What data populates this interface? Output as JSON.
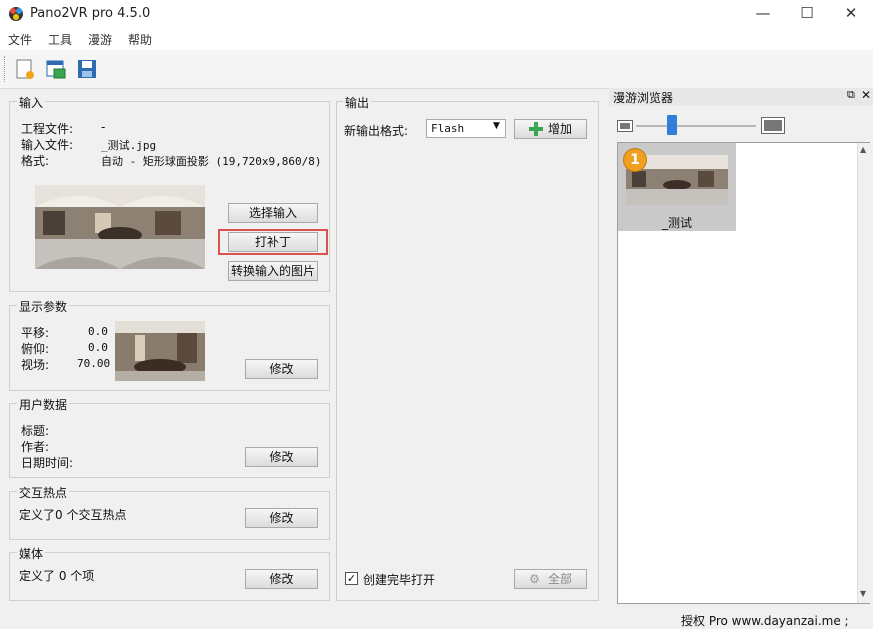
{
  "window": {
    "title": "Pano2VR pro 4.5.0",
    "minimize_glyph": "—",
    "maximize_glyph": "☐",
    "close_glyph": "✕"
  },
  "menu": [
    "文件",
    "工具",
    "漫游",
    "帮助"
  ],
  "toolbar": {
    "icons": [
      "new-project-icon",
      "open-project-icon",
      "save-project-icon"
    ]
  },
  "input_group": {
    "title": "输入",
    "project_file_label": "工程文件:",
    "project_file_value": "-",
    "input_file_label": "输入文件:",
    "input_file_value": "_测试.jpg",
    "format_label": "格式:",
    "format_value": "自动 - 矩形球面投影 (19,720x9,860/8)",
    "select_input_button": "选择输入",
    "patch_button": "打补丁",
    "convert_button": "转换输入的图片"
  },
  "display_group": {
    "title": "显示参数",
    "pan_label": "平移:",
    "pan_value": "0.0",
    "tilt_label": "俯仰:",
    "tilt_value": "0.0",
    "fov_label": "视场:",
    "fov_value": "70.00",
    "modify_button": "修改"
  },
  "user_data_group": {
    "title": "用户数据",
    "title_label": "标题:",
    "author_label": "作者:",
    "datetime_label": "日期时间:",
    "modify_button": "修改"
  },
  "hotspot_group": {
    "title": "交互热点",
    "summary": "定义了0 个交互热点",
    "modify_button": "修改"
  },
  "media_group": {
    "title": "媒体",
    "summary": "定义了 0 个项",
    "modify_button": "修改"
  },
  "output_group": {
    "title": "输出",
    "new_format_label": "新输出格式:",
    "format_selected": "Flash",
    "add_button": "增加",
    "open_after_label": "创建完毕打开",
    "open_after_checked": true,
    "all_button": "全部"
  },
  "tour_browser": {
    "title": "漫游浏览器",
    "zoom_level": 0.3,
    "items": [
      {
        "badge": "1",
        "label": "_测试"
      }
    ]
  },
  "status_bar": {
    "text": "授权 Pro  www.dayanzai.me ;"
  },
  "colors": {
    "highlight_border": "#d9534f",
    "slider_thumb": "#2f7fd6",
    "badge": "#f0a020"
  }
}
